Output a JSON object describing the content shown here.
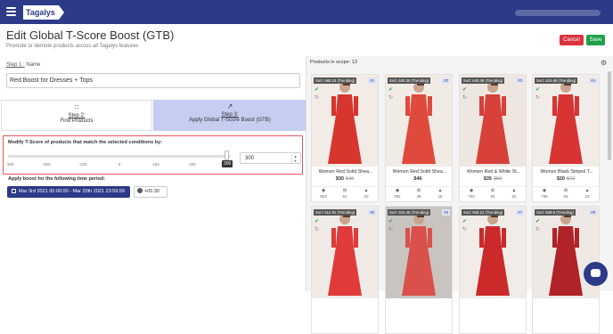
{
  "topbar": {
    "logo": "Tagalys"
  },
  "page": {
    "title": "Edit Global T-Score Boost (GTB)",
    "subtitle": "Promote or demote products across all Tagalys features",
    "cancel_label": "Cancel",
    "save_label": "Save"
  },
  "step1": {
    "step": "Step 1 :",
    "label": "Name",
    "value": "Red Boost for Dresses + Tops"
  },
  "tabs": [
    {
      "step": "Step 2:",
      "label": "Find Products",
      "icon": "grid-icon",
      "active": false
    },
    {
      "step": "Step 3:",
      "label": "Apply Global T-Score Boost (GTB)",
      "icon": "trend-icon",
      "active": true
    }
  ],
  "modify": {
    "label": "Modify T-Score of products that match the selected conditions by:",
    "ticks": [
      "-300",
      "-200",
      "-100",
      "0",
      "100",
      "200",
      "300"
    ],
    "min": -300,
    "max": 300,
    "value": 300,
    "tooltip": "300",
    "input_value": "300"
  },
  "boost_period": {
    "label": "Apply boost for the following time period:",
    "range": "Mar 3rd 2021 00:00:00 - Mar 20th 2021 23:59:59",
    "timezone": "+05:30"
  },
  "products_panel": {
    "scope_label": "Products in scope: 13",
    "products": [
      {
        "sort": "Sort: 665.24 (Trending)",
        "rank": "#1",
        "name": "Women Red Solid Shea...",
        "price": "$30",
        "old_price": "$49",
        "views": "923",
        "adds": "51",
        "buys": "20",
        "checked": true,
        "dress_color": "#d7362f",
        "bg": "#f3ece6"
      },
      {
        "sort": "Sort: 640.35 (Trending)",
        "rank": "#2",
        "name": "Women Red Solid Shea...",
        "price": "$46",
        "old_price": "",
        "views": "781",
        "adds": "48",
        "buys": "16",
        "checked": true,
        "dress_color": "#e04a3c",
        "bg": "#f1ebe6"
      },
      {
        "sort": "Sort: 640.36 (Trending)",
        "rank": "#3",
        "name": "Women Red & White St...",
        "price": "$35",
        "old_price": "$59",
        "views": "732",
        "adds": "93",
        "buys": "22",
        "checked": true,
        "dress_color": "#d8403a",
        "bg": "#eee7e1"
      },
      {
        "sort": "Sort: 624.68 (Trending)",
        "rank": "#4",
        "name": "Women Black Striped T...",
        "price": "$20",
        "old_price": "$72",
        "views": "706",
        "adds": "53",
        "buys": "23",
        "checked": true,
        "dress_color": "#d83434",
        "bg": "#f2ece8"
      },
      {
        "sort": "Sort: 612.91 (Trending)",
        "rank": "#5",
        "name": "",
        "price": "",
        "old_price": "",
        "views": "",
        "adds": "",
        "buys": "",
        "checked": true,
        "dress_color": "#e03a3a",
        "bg": "#f0ebe7"
      },
      {
        "sort": "Sort: 610.45 (Trending)",
        "rank": "#6",
        "name": "",
        "price": "",
        "old_price": "",
        "views": "",
        "adds": "",
        "buys": "",
        "checked": true,
        "dress_color": "#d9514a",
        "bg": "#c9c4c0"
      },
      {
        "sort": "Sort: 609.22 (Trending)",
        "rank": "#7",
        "name": "",
        "price": "",
        "old_price": "",
        "views": "",
        "adds": "",
        "buys": "",
        "checked": true,
        "dress_color": "#cc2a2a",
        "bg": "#f1ece8"
      },
      {
        "sort": "Sort: 608.8 (Trending)",
        "rank": "#8",
        "name": "",
        "price": "",
        "old_price": "",
        "views": "",
        "adds": "",
        "buys": "",
        "checked": true,
        "dress_color": "#b02328",
        "bg": "#eee9e5"
      }
    ]
  },
  "colors": {
    "brand": "#2c3a87",
    "cancel": "#d9333c",
    "save": "#20a24a",
    "highlight": "#e6555b"
  }
}
